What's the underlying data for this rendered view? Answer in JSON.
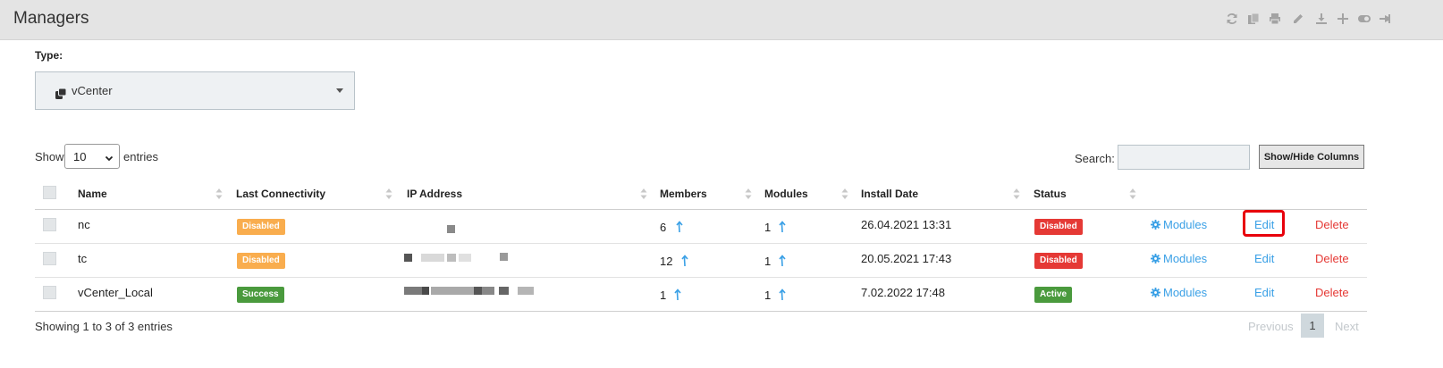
{
  "header": {
    "title": "Managers",
    "toolbar_icons": [
      "refresh-icon",
      "copy-icon",
      "print-icon",
      "edit-pencil-icon",
      "download-icon",
      "plus-icon",
      "toggle-icon",
      "pin-icon"
    ]
  },
  "filter": {
    "type_label": "Type:",
    "type_value": "vCenter"
  },
  "table_controls": {
    "show_label": "Show",
    "length_value": "10",
    "entries_label": "entries",
    "search_label": "Search:",
    "search_value": "",
    "show_hide_label": "Show/Hide Columns"
  },
  "columns": [
    "Name",
    "Last Connectivity",
    "IP Address",
    "Members",
    "Modules",
    "Install Date",
    "Status"
  ],
  "rows": [
    {
      "name": "nc",
      "connectivity": "Disabled",
      "members": "6",
      "modules": "1",
      "install_date": "26.04.2021 13:31",
      "status": "Disabled",
      "modules_link": "Modules",
      "edit_link": "Edit",
      "delete_link": "Delete"
    },
    {
      "name": "tc",
      "connectivity": "Disabled",
      "members": "12",
      "modules": "1",
      "install_date": "20.05.2021 17:43",
      "status": "Disabled",
      "modules_link": "Modules",
      "edit_link": "Edit",
      "delete_link": "Delete"
    },
    {
      "name": "vCenter_Local",
      "connectivity": "Success",
      "members": "1",
      "modules": "1",
      "install_date": "7.02.2022 17:48",
      "status": "Active",
      "modules_link": "Modules",
      "edit_link": "Edit",
      "delete_link": "Delete"
    }
  ],
  "footer": {
    "info": "Showing 1 to 3 of 3 entries",
    "previous": "Previous",
    "current_page": "1",
    "next": "Next"
  },
  "colors": {
    "warning_badge": "#f9ad4e",
    "success_badge": "#4a9a3d",
    "danger_badge": "#e53935",
    "link": "#3aa0e6",
    "delete": "#e53935",
    "highlight": "#e8000b"
  }
}
